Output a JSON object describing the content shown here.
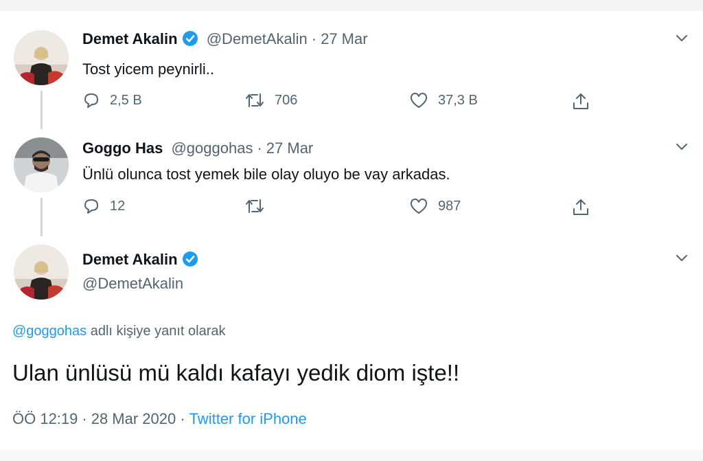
{
  "tweet1": {
    "name": "Demet Akalin",
    "handle": "@DemetAkalin",
    "date": "27 Mar",
    "text": "Tost yicem peynirli..",
    "replies": "2,5 B",
    "retweets": "706",
    "likes": "37,3 B",
    "verified": true
  },
  "tweet2": {
    "name": "Goggo Has",
    "handle": "@goggohas",
    "date": "27 Mar",
    "text": "Ünlü olunca tost yemek bile olay oluyo be vay arkadas.",
    "replies": "12",
    "retweets": "",
    "likes": "987"
  },
  "tweet3": {
    "name": "Demet Akalin",
    "handle": "@DemetAkalin",
    "reply_mention": "@goggohas",
    "reply_suffix": " adlı kişiye yanıt olarak",
    "text": "Ulan ünlüsü mü kaldı kafayı yedik diom işte!!",
    "time": "ÖÖ 12:19",
    "date": "28 Mar 2020",
    "source": "Twitter for iPhone",
    "verified": true
  },
  "separator": "·",
  "colors": {
    "accent": "#1d9bf0",
    "secondary_text": "#536471",
    "thread_line": "#cfd9de"
  },
  "icons": [
    "reply-icon",
    "retweet-icon",
    "like-icon",
    "share-icon",
    "chevron-down-icon",
    "verified-badge-icon"
  ]
}
